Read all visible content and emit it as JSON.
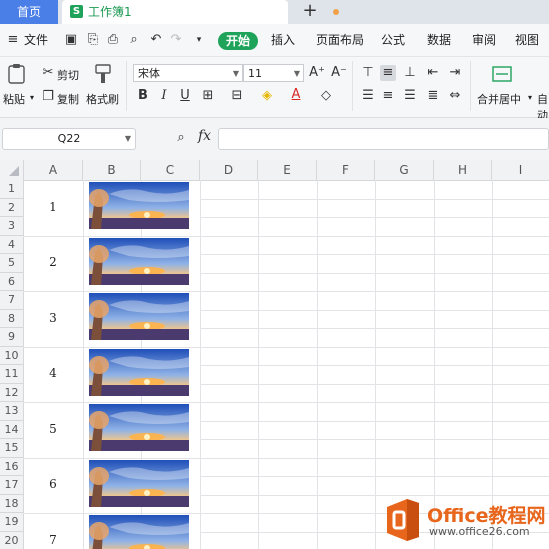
{
  "tabs": {
    "home": "首页",
    "doc": "工作簿1",
    "doc_icon": "S"
  },
  "menu": {
    "file": "文件",
    "items": [
      "开始",
      "插入",
      "页面布局",
      "公式",
      "数据",
      "审阅",
      "视图"
    ]
  },
  "ribbon": {
    "paste": "粘贴",
    "cut": "剪切",
    "copy": "复制",
    "format_painter": "格式刷",
    "font_name": "宋体",
    "font_size": "11",
    "merge_center": "合并居中",
    "auto_wrap": "自动"
  },
  "formula": {
    "cell_ref": "Q22",
    "fx": "fx",
    "value": ""
  },
  "columns": [
    "A",
    "B",
    "C",
    "D",
    "E",
    "F",
    "G",
    "H",
    "I"
  ],
  "rows": [
    "1",
    "2",
    "3",
    "4",
    "5",
    "6",
    "7",
    "8",
    "9",
    "10",
    "11",
    "12",
    "13",
    "14",
    "15",
    "16",
    "17",
    "18",
    "19",
    "20"
  ],
  "cells": [
    "1",
    "2",
    "3",
    "4",
    "5",
    "6",
    "7"
  ],
  "watermark": {
    "title": "Office教程网",
    "url": "www.office26.com"
  },
  "colors": {
    "accent": "#1fa35a",
    "home_tab": "#4b7fe8",
    "watermark": "#e8661c"
  }
}
